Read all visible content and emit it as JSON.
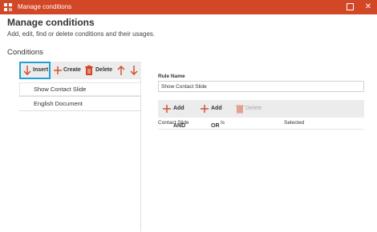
{
  "window": {
    "title": "Manage conditions"
  },
  "header": {
    "title": "Manage conditions",
    "subtitle": "Add, edit, find or delete conditions and their usages."
  },
  "conditions": {
    "section_title": "Conditions",
    "toolbar": {
      "insert": "Insert",
      "create": "Create",
      "delete": "Delete"
    },
    "items": [
      {
        "label": "Show Contact Slide",
        "selected": true
      },
      {
        "label": "English Document",
        "selected": false
      }
    ]
  },
  "rule": {
    "name_label": "Rule Name",
    "name_value": "Show Contact Slide",
    "toolbar": {
      "add_and": "Add AND",
      "add_or": "Add OR",
      "delete": "Delete"
    },
    "rows": [
      {
        "field": "Contact Slide",
        "operator": "Is",
        "value": "Selected"
      }
    ]
  },
  "colors": {
    "titlebar": "#d24726",
    "accent_red": "#d24726",
    "focus_outline": "#1fa0d8"
  }
}
